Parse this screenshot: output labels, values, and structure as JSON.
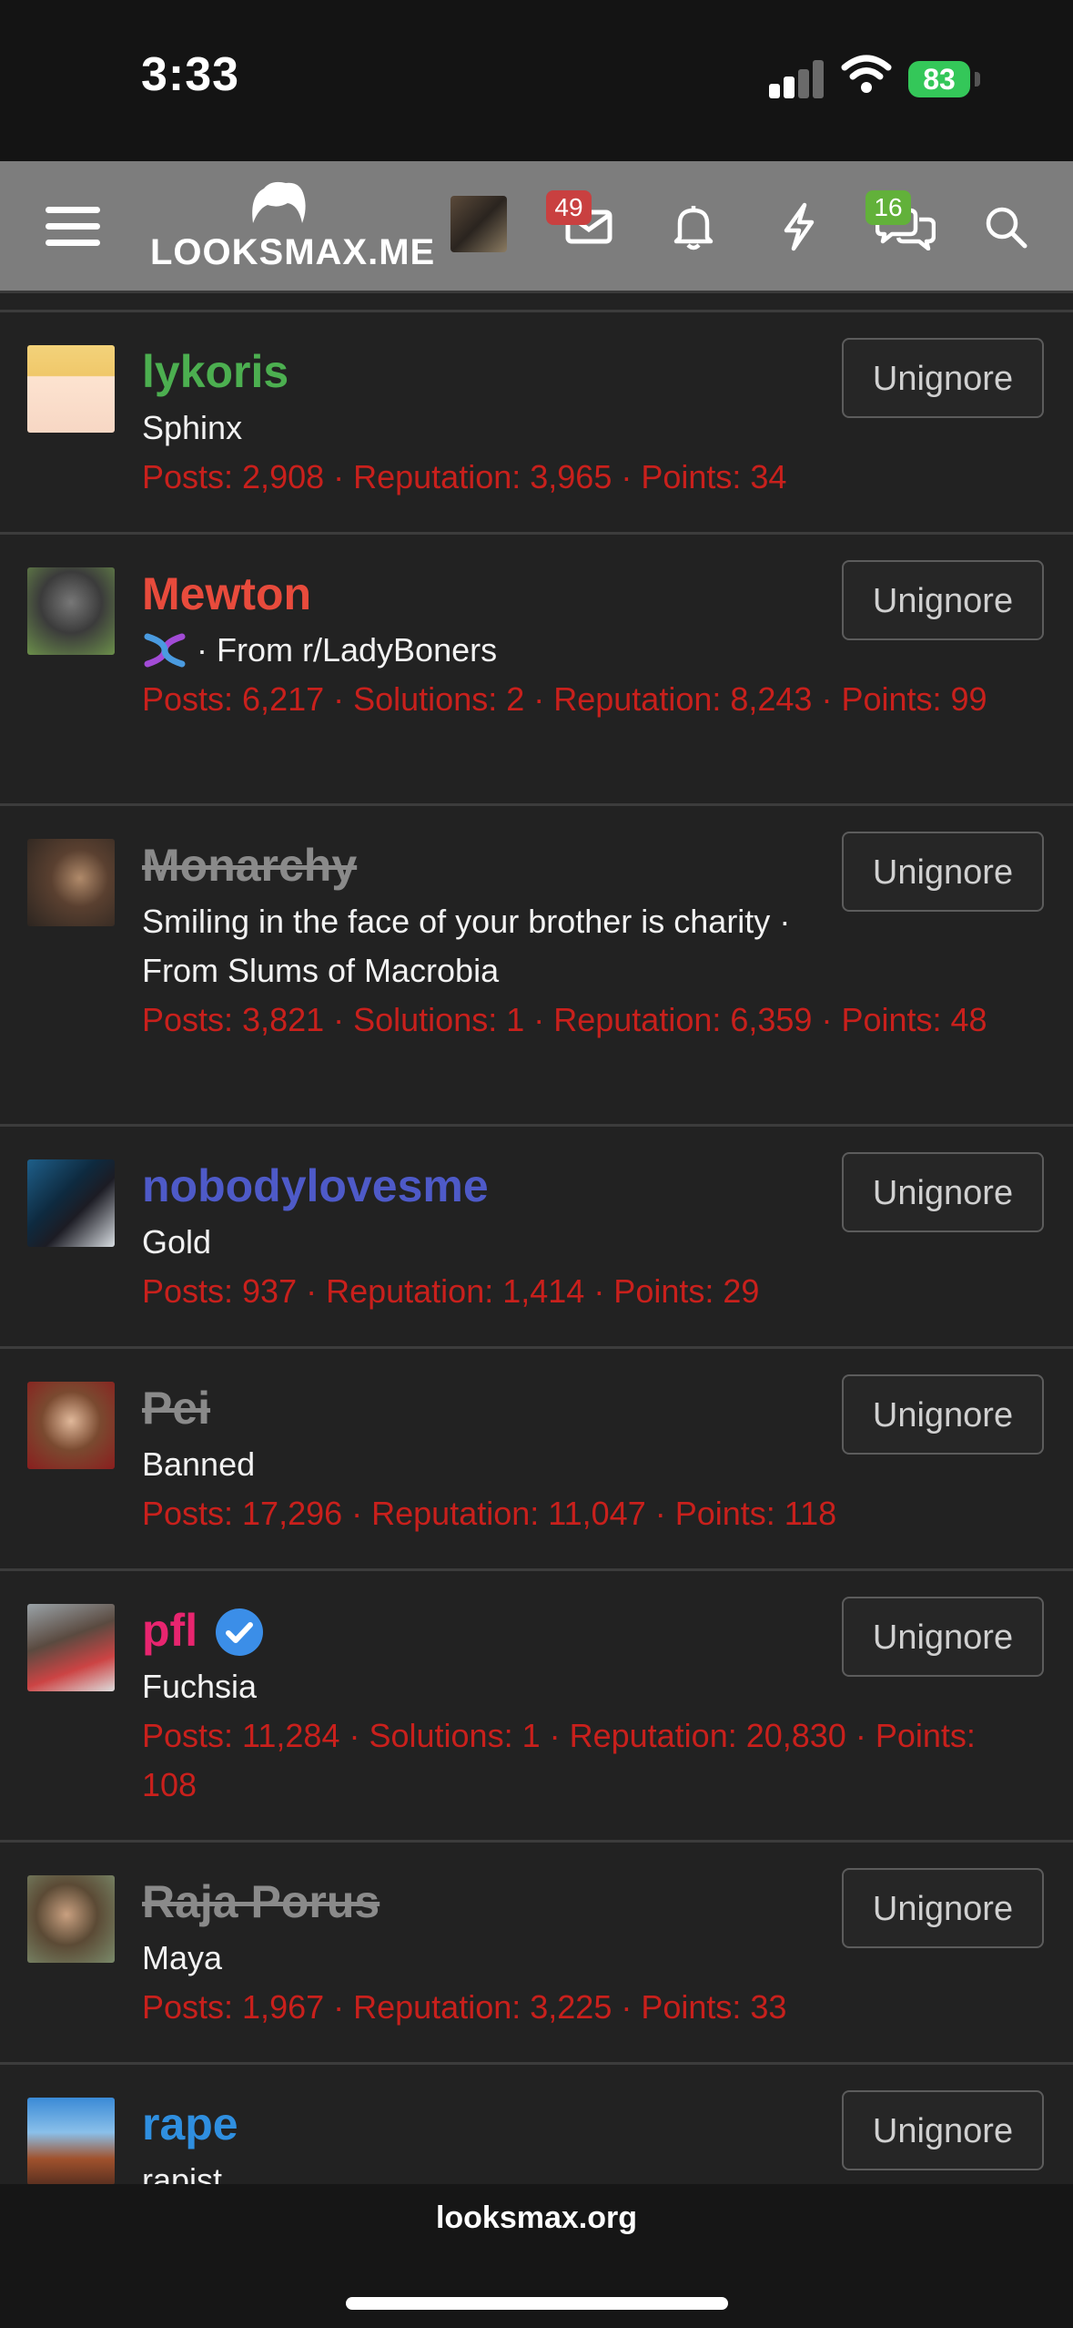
{
  "status": {
    "time": "3:33",
    "battery": "83"
  },
  "nav": {
    "logo": "LOOKSMAX.ME",
    "inbox_count": "49",
    "conversations_count": "16"
  },
  "users": [
    {
      "name": "lykoris",
      "name_color": "#4caf50",
      "title": "Sphinx",
      "stats": "Posts: 2,908 · Reputation: 3,965 · Points: 34",
      "button": "Unignore",
      "banned": false
    },
    {
      "name": "Mewton",
      "name_color": "#e84b3c",
      "title": "· From r/LadyBoners",
      "stats": "Posts: 6,217 · Solutions: 2 · Reputation: 8,243 · Points: 99",
      "button": "Unignore",
      "banned": false
    },
    {
      "name": "Monarchy",
      "name_color": "#8a8a8a",
      "title": "Smiling in the face of your brother is charity · From Slums of Macrobia",
      "stats": "Posts: 3,821 · Solutions: 1 · Reputation: 6,359 · Points: 48",
      "button": "Unignore",
      "banned": true
    },
    {
      "name": "nobodylovesme",
      "name_color": "#4e5ac8",
      "title": "Gold",
      "stats": "Posts: 937 · Reputation: 1,414 · Points: 29",
      "button": "Unignore",
      "banned": false
    },
    {
      "name": "Pei",
      "name_color": "#8a8a8a",
      "title": "Banned",
      "stats": "Posts: 17,296 · Reputation: 11,047 · Points: 118",
      "button": "Unignore",
      "banned": true
    },
    {
      "name": "pfl",
      "name_color": "#e8256f",
      "title": "Fuchsia",
      "stats": "Posts: 11,284 · Solutions: 1 · Reputation: 20,830 · Points: 108",
      "button": "Unignore",
      "banned": false
    },
    {
      "name": "Raja Porus",
      "name_color": "#8a8a8a",
      "title": "Maya",
      "stats": "Posts: 1,967 · Reputation: 3,225 · Points: 33",
      "button": "Unignore",
      "banned": true
    },
    {
      "name": "rape",
      "name_color": "#2f8fe0",
      "title": "rapist",
      "stats": "",
      "button": "Unignore",
      "banned": false
    }
  ],
  "footer": {
    "url": "looksmax.org"
  }
}
